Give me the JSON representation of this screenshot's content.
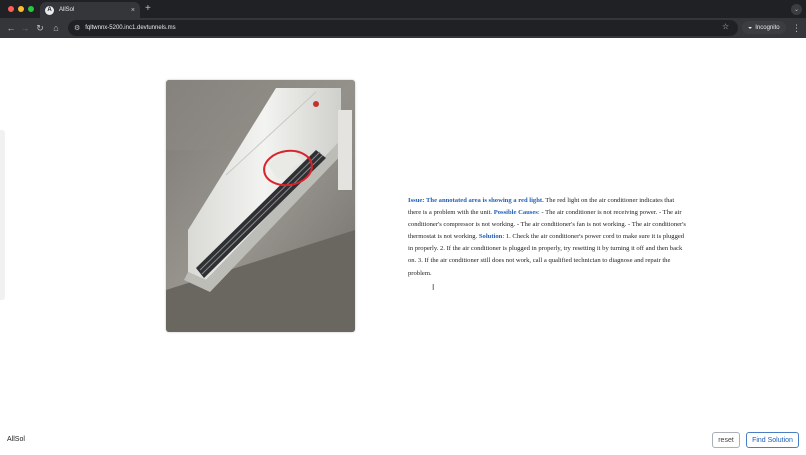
{
  "browser": {
    "tab_title": "AllSol",
    "tab_favicon_letter": "A",
    "tab_close": "×",
    "new_tab": "+",
    "url": "fqltwnnx-5200.inc1.devtunnels.ms",
    "incognito_label": "Incognito",
    "icons": {
      "back": "arrow-left-icon",
      "forward": "arrow-right-icon",
      "reload": "reload-icon",
      "home": "home-icon",
      "site_info": "site-info-icon",
      "bookmark": "star-icon",
      "incognito": "incognito-icon",
      "menu": "kebab-menu-icon"
    }
  },
  "result": {
    "issue_label": "Issue: The annotated area is showing a red light.",
    "issue_text": " The red light on the air conditioner indicates that there is a problem with the unit. ",
    "causes_label": "Possible Causes",
    "causes_text": ": - The air conditioner is not receiving power. - The air conditioner's compressor is not working. - The air conditioner's fan is not working. - The air conditioner's thermostat is not working. ",
    "solution_label": "Solution",
    "solution_text": ": 1. Check the air conditioner's power cord to make sure it is plugged in properly. 2. If the air conditioner is plugged in properly, try resetting it by turning it off and then back on. 3. If the air conditioner still does not work, call a qualified technician to diagnose and repair the problem."
  },
  "footer": {
    "brand": "AllSol",
    "reset_label": "reset",
    "find_label": "Find Solution"
  },
  "colors": {
    "highlight": "#1e5fb4",
    "annotation": "#d8242a",
    "chrome_bg": "#202124"
  }
}
